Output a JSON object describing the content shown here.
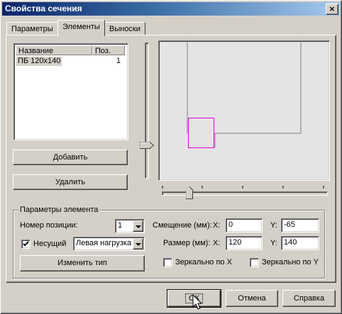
{
  "window": {
    "title": "Свойства сечения",
    "close_label": "×"
  },
  "tabs": [
    {
      "label": "Параметры"
    },
    {
      "label": "Элементы"
    },
    {
      "label": "Выноски"
    }
  ],
  "list": {
    "columns": [
      "Название",
      "Поз."
    ],
    "rows": [
      {
        "name": "ПБ 120х140",
        "pos": "1"
      }
    ]
  },
  "buttons": {
    "add": "Добавить",
    "delete": "Удалить",
    "change_type": "Изменить тип",
    "ok": "ОК",
    "cancel": "Отмена",
    "help": "Справка"
  },
  "params": {
    "group_title": "Параметры элемента",
    "position_label": "Номер позиции:",
    "position_value": "1",
    "carrier_label": "Несущий",
    "carrier_checked": true,
    "load_value": "Левая нагрузка",
    "offset_label": "Смещение (мм):",
    "x_label": "X:",
    "y_label": "Y:",
    "offset_x": "0",
    "offset_y": "-65",
    "size_label": "Размер (мм):",
    "size_x": "120",
    "size_y": "140",
    "mirror_x": "Зеркально по X",
    "mirror_y": "Зеркально по Y"
  },
  "colors": {
    "selection_rect": "#e000e0",
    "drawing_lines": "#808080",
    "canvas_bg": "#e4e4e4"
  }
}
